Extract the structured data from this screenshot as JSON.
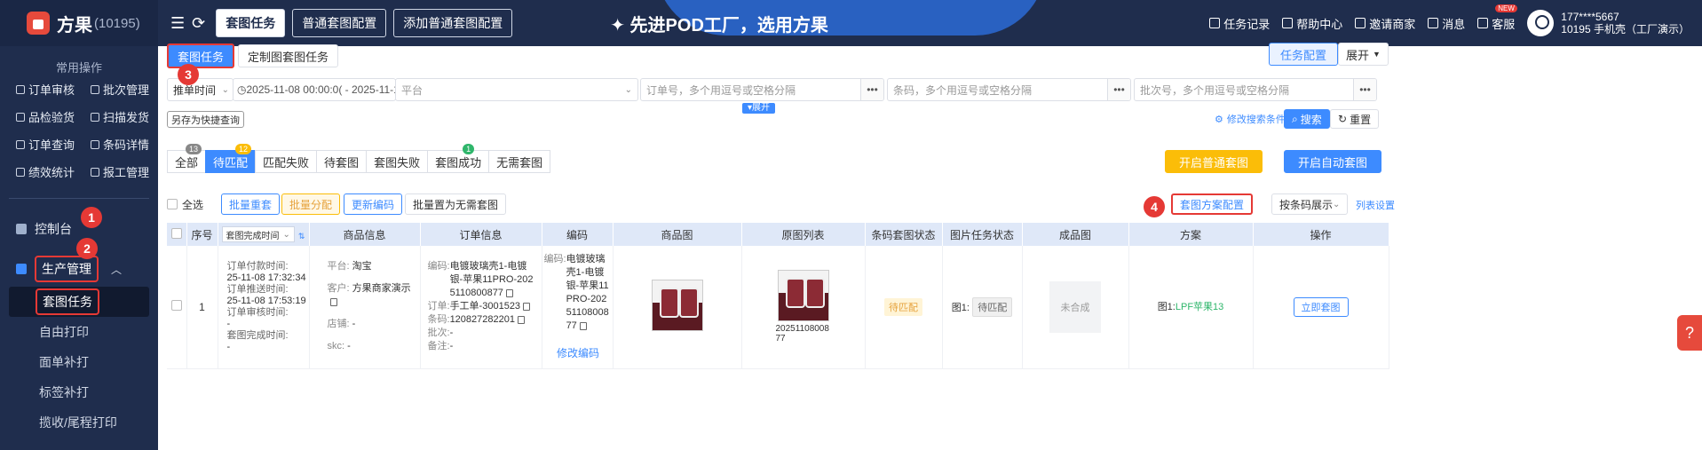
{
  "brand": {
    "name": "方果",
    "id": "(10195)"
  },
  "sidebar": {
    "section_title": "常用操作",
    "quick": [
      {
        "label": "订单审核"
      },
      {
        "label": "批次管理"
      },
      {
        "label": "品检验货"
      },
      {
        "label": "扫描发货"
      },
      {
        "label": "订单查询"
      },
      {
        "label": "条码详情"
      },
      {
        "label": "绩效统计"
      },
      {
        "label": "报工管理"
      }
    ],
    "console": "控制台",
    "production": "生产管理",
    "subs": [
      {
        "label": "套图任务"
      },
      {
        "label": "自由打印"
      },
      {
        "label": "面单补打"
      },
      {
        "label": "标签补打"
      },
      {
        "label": "揽收/尾程打印"
      }
    ]
  },
  "topbar": {
    "tabs": [
      {
        "label": "套图任务"
      },
      {
        "label": "普通套图配置"
      },
      {
        "label": "添加普通套图配置"
      }
    ],
    "slogan": "✦ 先进POD工厂，选用方果",
    "links": [
      {
        "label": "任务记录"
      },
      {
        "label": "帮助中心"
      },
      {
        "label": "邀请商家"
      },
      {
        "label": "消息"
      },
      {
        "label": "客服"
      }
    ],
    "new_badge": "NEW",
    "user_line1": "177****5667",
    "user_line2": "10195 手机壳（工厂演示）"
  },
  "page_tabs": [
    {
      "label": "套图任务"
    },
    {
      "label": "定制图套图任务"
    }
  ],
  "task_config": "任务配置",
  "expand_top": "展开",
  "filters": {
    "time_type": "推单时间",
    "date_range": "2025-11-08 00:00:0( - 2025-11-11 23:59:5",
    "platform": "平台",
    "order_no": "订单号，多个用逗号或空格分隔",
    "barcode": "条码，多个用逗号或空格分隔",
    "batch_no": "批次号，多个用逗号或空格分隔",
    "dots": "•••"
  },
  "expand_toggle": "▾展开",
  "save_quick": "另存为快捷查询",
  "modify_cond": "修改搜索条件",
  "search": "搜索",
  "reset": "重置",
  "status_tabs": [
    {
      "label": "全部",
      "count": "13"
    },
    {
      "label": "待匹配",
      "count": "12"
    },
    {
      "label": "匹配失败",
      "count": ""
    },
    {
      "label": "待套图",
      "count": ""
    },
    {
      "label": "套图失败",
      "count": ""
    },
    {
      "label": "套图成功",
      "count": "1"
    },
    {
      "label": "无需套图",
      "count": ""
    }
  ],
  "open_normal": "开启普通套图",
  "open_auto": "开启自动套图",
  "toolbar": {
    "select_all": "全选",
    "batch_redo": "批量重套",
    "batch_assign": "批量分配",
    "update_code": "更新编码",
    "batch_none": "批量置为无需套图",
    "scheme_config": "套图方案配置",
    "display_mode": "按条码展示",
    "col_settings": "列表设置"
  },
  "table": {
    "headers": [
      "序号",
      "套图完成时间",
      "商品信息",
      "订单信息",
      "编码",
      "商品图",
      "原图列表",
      "条码套图状态",
      "图片任务状态",
      "成品图",
      "方案",
      "操作"
    ],
    "row": {
      "index": "1",
      "times": [
        "订单付款时间:",
        "25-11-08 17:32:34",
        "订单推送时间:",
        "25-11-08 17:53:19",
        "订单审核时间:",
        "-",
        "套图完成时间:",
        "-"
      ],
      "platform_k": "平台:",
      "platform": "淘宝",
      "customer_k": "客户:",
      "customer": "方果商家演示",
      "shop_k": "店铺:",
      "shop": "-",
      "skc_k": "skc:",
      "skc": "-",
      "code_k": "编码:",
      "code": "电镀玻璃壳1-电镀银-苹果11PRO-2025110800877",
      "order_k": "订单:",
      "order": "手工单-3001523",
      "barcode_k": "条码:",
      "barcode": "120827282201",
      "batch_k": "批次:",
      "batch": "-",
      "remark_k": "备注:",
      "remark": "-",
      "enc_k": "编码:",
      "enc": "电镀玻璃壳1-电镀银-苹果11PRO-2025110800877",
      "modify_code": "修改编码",
      "orig_name": "2025110800877",
      "barcode_status": "待匹配",
      "img_task_k": "图1:",
      "img_task": "待匹配",
      "finished": "未合成",
      "scheme_k": "图1:",
      "scheme": "LPF苹果13",
      "action": "立即套图"
    }
  },
  "steps": [
    "1",
    "2",
    "3",
    "4"
  ],
  "help": "?"
}
